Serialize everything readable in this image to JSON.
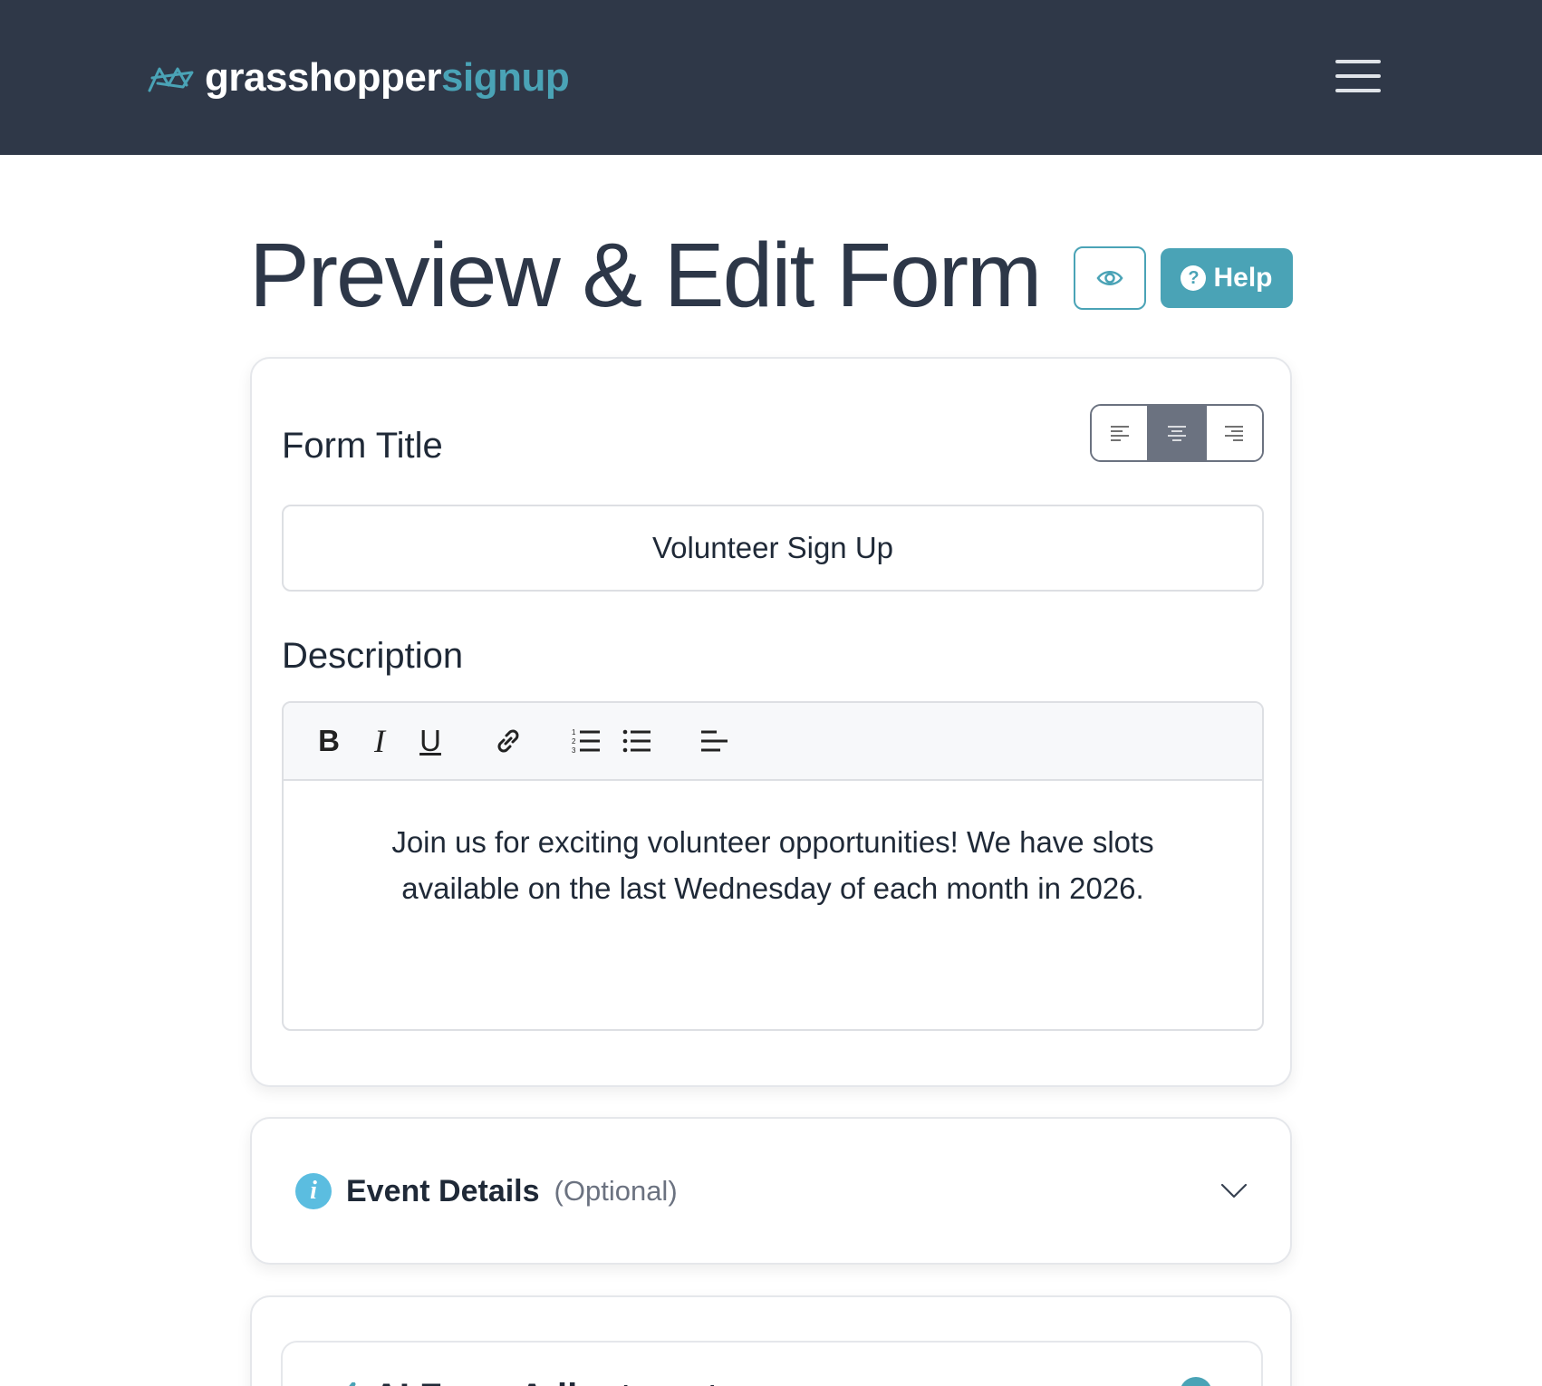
{
  "brand": {
    "name_part1": "grasshopper",
    "name_part2": "signup",
    "accent": "#4aa3b6",
    "nav_bg": "#2f3848"
  },
  "header": {
    "menu_icon": "hamburger-icon"
  },
  "page": {
    "title": "Preview & Edit Form",
    "preview_icon": "eye-icon",
    "help_label": "Help",
    "help_icon": "question-circle-icon"
  },
  "form": {
    "title_label": "Form Title",
    "title_value": "Volunteer Sign Up",
    "alignment": {
      "options": [
        "left",
        "center",
        "right"
      ],
      "selected": "center"
    },
    "description_label": "Description",
    "toolbar": {
      "bold": "B",
      "italic": "I",
      "underline": "U",
      "icons": [
        "link-icon",
        "ordered-list-icon",
        "bullet-list-icon",
        "text-align-icon"
      ]
    },
    "description_text": "Join us for exciting volunteer opportunities! We have slots available on the last Wednesday of each month in 2026."
  },
  "event_details": {
    "title": "Event Details",
    "optional": "(Optional)",
    "icon": "info-icon"
  },
  "ai_section": {
    "title": "AI Form Adjustment"
  }
}
